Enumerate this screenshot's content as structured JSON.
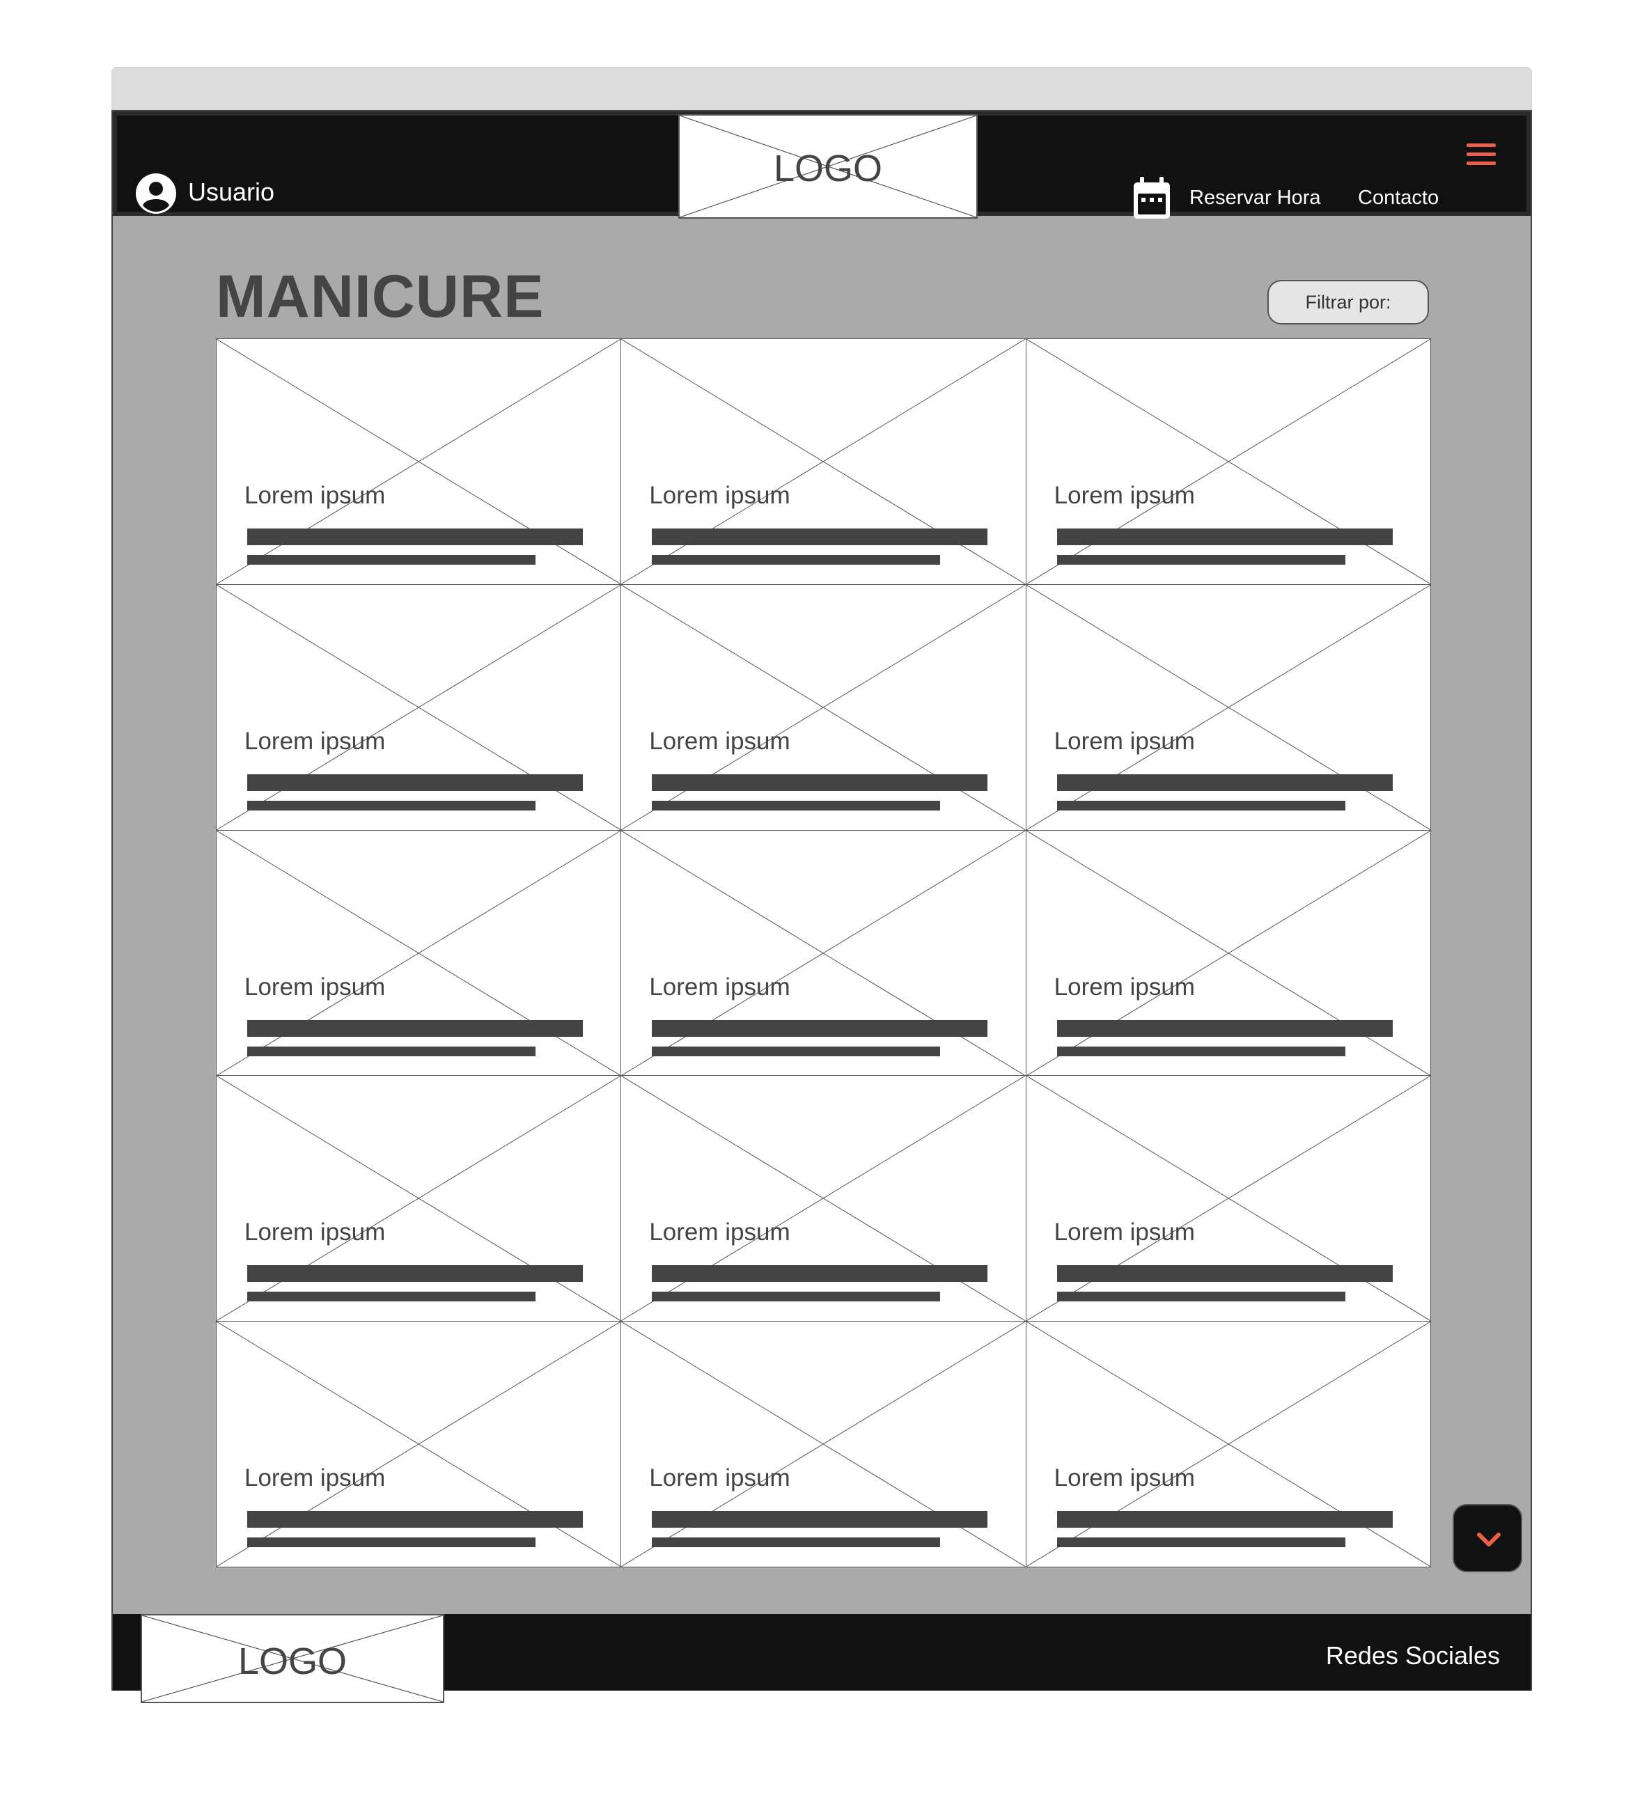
{
  "header": {
    "user_label": "Usuario",
    "logo_text": "LOGO",
    "nav": {
      "reservar": "Reservar Hora",
      "contacto": "Contacto"
    }
  },
  "main": {
    "title": "MANICURE",
    "filter_label": "Filtrar por:",
    "cards": [
      {
        "title": "Lorem ipsum"
      },
      {
        "title": "Lorem ipsum"
      },
      {
        "title": "Lorem ipsum"
      },
      {
        "title": "Lorem ipsum"
      },
      {
        "title": "Lorem ipsum"
      },
      {
        "title": "Lorem ipsum"
      },
      {
        "title": "Lorem ipsum"
      },
      {
        "title": "Lorem ipsum"
      },
      {
        "title": "Lorem ipsum"
      },
      {
        "title": "Lorem ipsum"
      },
      {
        "title": "Lorem ipsum"
      },
      {
        "title": "Lorem ipsum"
      },
      {
        "title": "Lorem ipsum"
      },
      {
        "title": "Lorem ipsum"
      },
      {
        "title": "Lorem ipsum"
      }
    ]
  },
  "footer": {
    "logo_text": "LOGO",
    "social_label": "Redes Sociales"
  },
  "icons": {
    "user": "user-circle-icon",
    "calendar": "calendar-icon",
    "menu": "hamburger-menu-icon",
    "scroll": "chevron-down-icon"
  },
  "colors": {
    "header_bg": "#111111",
    "page_bg": "#aaaaaa",
    "accent": "#e8604c",
    "text_dark": "#444444"
  }
}
